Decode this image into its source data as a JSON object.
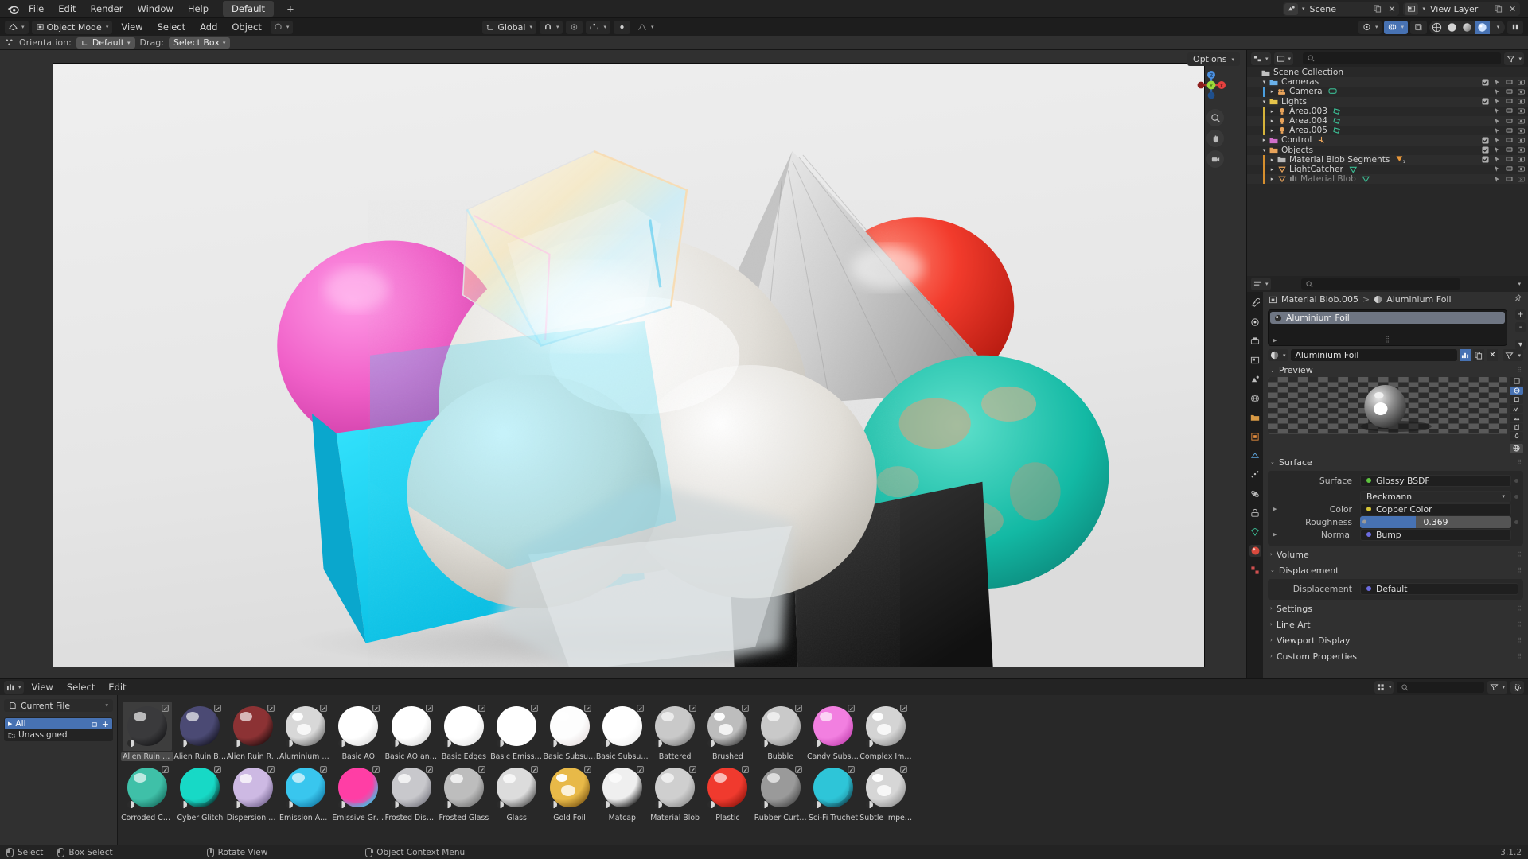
{
  "topbar": {
    "logo_icon": "blender-logo-icon",
    "menus": [
      "File",
      "Edit",
      "Render",
      "Window",
      "Help"
    ],
    "workspace_tab": "Default",
    "add_workspace_label": "+",
    "scene_field": {
      "icon": "scene-icon",
      "value": "Scene",
      "copy_icon": "copy-icon",
      "close_icon": "close-icon"
    },
    "viewlayer_field": {
      "icon": "view-layer-icon",
      "value": "View Layer",
      "copy_icon": "copy-icon",
      "close_icon": "close-icon"
    }
  },
  "viewport_header": {
    "editor_type_icon": "editor-type-3dview-icon",
    "mode": "Object Mode",
    "mode_icon": "object-mode-icon",
    "menus": [
      "View",
      "Select",
      "Add",
      "Object"
    ],
    "transform_orientation": "Global",
    "orientation_icon": "orientation-icon",
    "snap_icon": "magnet-icon",
    "proportional_icon": "proportional-edit-icon",
    "proportional_falloff_icon": "falloff-smooth-icon",
    "mirror_icon": "mirror-icon",
    "overlays_icon": "overlays-icon",
    "xray_icon": "xray-icon",
    "gizmo_icon": "gizmo-icon",
    "shading_modes": [
      "wireframe",
      "solid",
      "material-preview",
      "rendered"
    ],
    "shading_active": "rendered",
    "pause_icon": "pause-icon"
  },
  "tool_settings": {
    "tool_icon": "tweak-tool-icon",
    "orientation_label": "Orientation:",
    "orientation_value": "Default",
    "drag_label": "Drag:",
    "drag_value": "Select Box"
  },
  "viewport": {
    "options_label": "Options",
    "gizmo_axes": [
      "Z",
      "Y",
      "X"
    ],
    "nav_buttons": [
      "zoom-icon",
      "pan-hand-icon",
      "camera-view-icon"
    ]
  },
  "outliner": {
    "display_mode_icon": "outliner-icon",
    "filter_icon": "filter-icon",
    "search_placeholder": "",
    "search_icon": "search-icon",
    "rows": [
      {
        "label": "Scene Collection",
        "icon": "collection-icon",
        "indent": 0,
        "disclosure": "",
        "color": "#c0c0c0",
        "restrict": []
      },
      {
        "label": "Cameras",
        "icon": "collection-icon",
        "indent": 1,
        "disclosure": "down",
        "color": "#6ab0e8",
        "restrict": [
          "checkbox",
          "cursor",
          "monitor",
          "camera"
        ]
      },
      {
        "label": "Camera",
        "icon": "camera-data-icon",
        "indent": 2,
        "disclosure": "right",
        "color": "#e8a35a",
        "extra": "camera-obj-icon",
        "restrict": [
          "cursor",
          "monitor",
          "camera"
        ]
      },
      {
        "label": "Lights",
        "icon": "collection-icon",
        "indent": 1,
        "disclosure": "down",
        "color": "#e6c44a",
        "restrict": [
          "checkbox",
          "cursor",
          "monitor",
          "camera"
        ]
      },
      {
        "label": "Area.003",
        "icon": "light-icon",
        "indent": 2,
        "disclosure": "right",
        "color": "#e8a35a",
        "extra": "light-data-icon",
        "restrict": [
          "cursor",
          "monitor",
          "camera"
        ]
      },
      {
        "label": "Area.004",
        "icon": "light-icon",
        "indent": 2,
        "disclosure": "right",
        "color": "#e8a35a",
        "extra": "light-data-icon",
        "restrict": [
          "cursor",
          "monitor",
          "camera"
        ]
      },
      {
        "label": "Area.005",
        "icon": "light-icon",
        "indent": 2,
        "disclosure": "right",
        "color": "#e8a35a",
        "extra": "light-data-icon",
        "restrict": [
          "cursor",
          "monitor",
          "camera"
        ]
      },
      {
        "label": "Control",
        "icon": "collection-icon",
        "indent": 1,
        "disclosure": "right",
        "color": "#d06fc9",
        "extra": "empty-icon",
        "restrict": [
          "checkbox",
          "cursor",
          "monitor",
          "camera"
        ]
      },
      {
        "label": "Objects",
        "icon": "collection-icon",
        "indent": 1,
        "disclosure": "down",
        "color": "#e8a35a",
        "restrict": [
          "checkbox",
          "cursor",
          "monitor",
          "camera"
        ]
      },
      {
        "label": "Material Blob Segments",
        "icon": "collection-icon",
        "indent": 2,
        "disclosure": "right",
        "color": "#b8b8b8",
        "extra": "mesh-count-icon",
        "badge": "10",
        "restrict": [
          "checkbox",
          "cursor",
          "monitor",
          "camera"
        ]
      },
      {
        "label": "LightCatcher",
        "icon": "mesh-icon",
        "indent": 2,
        "disclosure": "right",
        "color": "#e8a35a",
        "extra": "mesh-data-icon",
        "restrict": [
          "cursor",
          "monitor",
          "camera"
        ]
      },
      {
        "label": "Material Blob",
        "icon": "mesh-icon",
        "indent": 2,
        "disclosure": "right",
        "color": "#e8a35a",
        "extra": "mesh-data-icon",
        "dim": true,
        "restrict": [
          "cursor",
          "monitor",
          "camera-off"
        ]
      }
    ]
  },
  "properties": {
    "editor_icon": "properties-editor-icon",
    "search_placeholder": "",
    "search_icon": "search-icon",
    "tabs": [
      "tool-icon",
      "render-icon",
      "output-icon",
      "view-layer-icon",
      "scene-icon",
      "world-icon",
      "collection-props-icon",
      "object-icon",
      "modifiers-icon",
      "particles-icon",
      "physics-icon",
      "constraints-icon",
      "data-icon",
      "material-icon",
      "texture-icon"
    ],
    "active_tab": "material-icon",
    "breadcrumb": {
      "object_icon": "object-icon",
      "object": "Material Blob.005",
      "separator": ">",
      "material_icon": "material-icon",
      "material": "Aluminium Foil"
    },
    "pin_icon": "pin-icon",
    "slot_list": {
      "slots": [
        "Aluminium Foil"
      ],
      "add_icon": "+",
      "remove_icon": "-",
      "menu_icon": "chevron-down-icon"
    },
    "material_id": {
      "browse_icon": "material-browse-icon",
      "name": "Aluminium Foil",
      "fake_user_icon": "fake-user-icon",
      "copies_icon": "new-material-icon",
      "unlink_icon": "x-icon",
      "nodes_icon": "node-filter-icon"
    },
    "sections": {
      "preview": {
        "label": "Preview",
        "expanded": true,
        "shape_buttons": [
          "plane",
          "sphere",
          "cube",
          "hair",
          "shader-ball",
          "cloth",
          "fluid"
        ],
        "active_shape": "sphere",
        "world_btn": "world-preview-icon"
      },
      "surface": {
        "label": "Surface",
        "expanded": true,
        "rows": [
          {
            "label": "Surface",
            "value": "Glossy BSDF",
            "socket": "#5ec43f",
            "type": "node"
          },
          {
            "label": "",
            "value": "Beckmann",
            "type": "dropdown"
          },
          {
            "label": "Color",
            "value": "Copper Color",
            "socket": "#d6c436",
            "type": "node",
            "tri": true
          },
          {
            "label": "Roughness",
            "value": "0.369",
            "type": "slider",
            "fill": 0.369
          },
          {
            "label": "Normal",
            "value": "Bump",
            "socket": "#6b6bdf",
            "type": "node",
            "tri": true
          }
        ]
      },
      "volume": {
        "label": "Volume",
        "expanded": false
      },
      "displacement": {
        "label": "Displacement",
        "expanded": true,
        "rows": [
          {
            "label": "Displacement",
            "value": "Default",
            "socket": "#6b6bdf",
            "type": "node"
          }
        ]
      },
      "settings": {
        "label": "Settings",
        "expanded": false
      },
      "line_art": {
        "label": "Line Art",
        "expanded": false
      },
      "viewport_display": {
        "label": "Viewport Display",
        "expanded": false
      },
      "custom_properties": {
        "label": "Custom Properties",
        "expanded": false
      }
    }
  },
  "asset_browser": {
    "editor_icon": "asset-browser-icon",
    "menus": [
      "View",
      "Select",
      "Edit"
    ],
    "display_icon": "display-mode-icon",
    "search_icon": "search-icon",
    "search_placeholder": "",
    "filter_icon": "filter-icon",
    "settings_icon": "gear-icon",
    "library_dropdown": {
      "icon": "file-icon",
      "value": "Current File"
    },
    "catalogs": [
      {
        "label": "All",
        "selected": true,
        "icon": "disclosure-right-icon"
      },
      {
        "label": "Unassigned",
        "selected": false,
        "icon": "unassigned-icon"
      }
    ],
    "assets": [
      {
        "name": "Alien Ruin Blackish",
        "colors": [
          "#3a3a3c",
          "#141416"
        ],
        "selected": true,
        "rough": true
      },
      {
        "name": "Alien Ruin Bluish",
        "colors": [
          "#4b4a74",
          "#14131f"
        ],
        "rough": true
      },
      {
        "name": "Alien Ruin Redish",
        "colors": [
          "#8c3234",
          "#1d0c0d"
        ],
        "rough": true
      },
      {
        "name": "Aluminium Foil",
        "colors": [
          "#d8d8d8",
          "#6a6a6a"
        ],
        "metal": true
      },
      {
        "name": "Basic AO",
        "colors": [
          "#ffffff",
          "#d8d8d8"
        ]
      },
      {
        "name": "Basic AO and Edge..",
        "colors": [
          "#ffffff",
          "#d5d5d5"
        ]
      },
      {
        "name": "Basic Edges",
        "colors": [
          "#ffffff",
          "#e2e2e2"
        ]
      },
      {
        "name": "Basic Emission",
        "colors": [
          "#ffffff",
          "#ffffff"
        ],
        "emissive": true
      },
      {
        "name": "Basic Subsurface a..",
        "colors": [
          "#fdfdfd",
          "#e6dede"
        ]
      },
      {
        "name": "Basic Subsurface B..",
        "colors": [
          "#ffffff",
          "#ededed"
        ]
      },
      {
        "name": "Battered",
        "colors": [
          "#c9c9c9",
          "#7a7a7a"
        ],
        "rough": true
      },
      {
        "name": "Brushed",
        "colors": [
          "#bdbdbd",
          "#3d3d3d"
        ],
        "metal": true
      },
      {
        "name": "Bubble",
        "colors": [
          "#c9c9c9",
          "#8e8e8e"
        ]
      },
      {
        "name": "Candy Subsurface",
        "colors": [
          "#f27fe0",
          "#c13fae"
        ]
      },
      {
        "name": "Complex Imperfect..",
        "colors": [
          "#d4d4d4",
          "#8a8a8a"
        ],
        "metal": true
      },
      {
        "name": "Corroded Copper",
        "colors": [
          "#3fc0a8",
          "#166b5d"
        ],
        "rough": true
      },
      {
        "name": "Cyber Glitch",
        "colors": [
          "#17d9c6",
          "#06201f"
        ],
        "emissive": true
      },
      {
        "name": "Dispersion Glass",
        "colors": [
          "#cdb9e3",
          "#6f5f8a"
        ],
        "glass": true
      },
      {
        "name": "Emission AO and E..",
        "colors": [
          "#39c6ee",
          "#1277a3"
        ]
      },
      {
        "name": "Emissive Gradient",
        "colors": [
          "#ff3ea5",
          "#22d3ee"
        ],
        "emissive": true
      },
      {
        "name": "Frosted Dispersion ...",
        "colors": [
          "#c8c8cc",
          "#75757e"
        ],
        "glass": true
      },
      {
        "name": "Frosted Glass",
        "colors": [
          "#bdbdbd",
          "#717171"
        ],
        "glass": true
      },
      {
        "name": "Glass",
        "colors": [
          "#dcdcdc",
          "#4e4e4e"
        ],
        "glass": true
      },
      {
        "name": "Gold Foil",
        "colors": [
          "#e8b948",
          "#7a5411"
        ],
        "metal": true
      },
      {
        "name": "Matcap",
        "colors": [
          "#efefef",
          "#0e0e0e"
        ]
      },
      {
        "name": "Material Blob",
        "colors": [
          "#cfcfcf",
          "#8b8b8b"
        ],
        "rough": true
      },
      {
        "name": "Plastic",
        "colors": [
          "#f03a2e",
          "#8c140c"
        ]
      },
      {
        "name": "Rubber Curtain",
        "colors": [
          "#9a9a9a",
          "#454545"
        ]
      },
      {
        "name": "Sci-Fi Truchet",
        "colors": [
          "#2ec5d8",
          "#0d3b49"
        ],
        "emissive": true
      },
      {
        "name": "Subtle Imperfection",
        "colors": [
          "#d6d6d6",
          "#8e8e8e"
        ],
        "metal": true
      }
    ]
  },
  "status_bar": {
    "items": [
      {
        "icon": "mouse-left-icon",
        "label": "Select"
      },
      {
        "icon": "mouse-left-drag-icon",
        "label": "Box Select"
      },
      {
        "icon": "mouse-middle-icon",
        "label": "Rotate View"
      },
      {
        "icon": "mouse-right-icon",
        "label": "Object Context Menu"
      }
    ],
    "version": "3.1.2"
  }
}
